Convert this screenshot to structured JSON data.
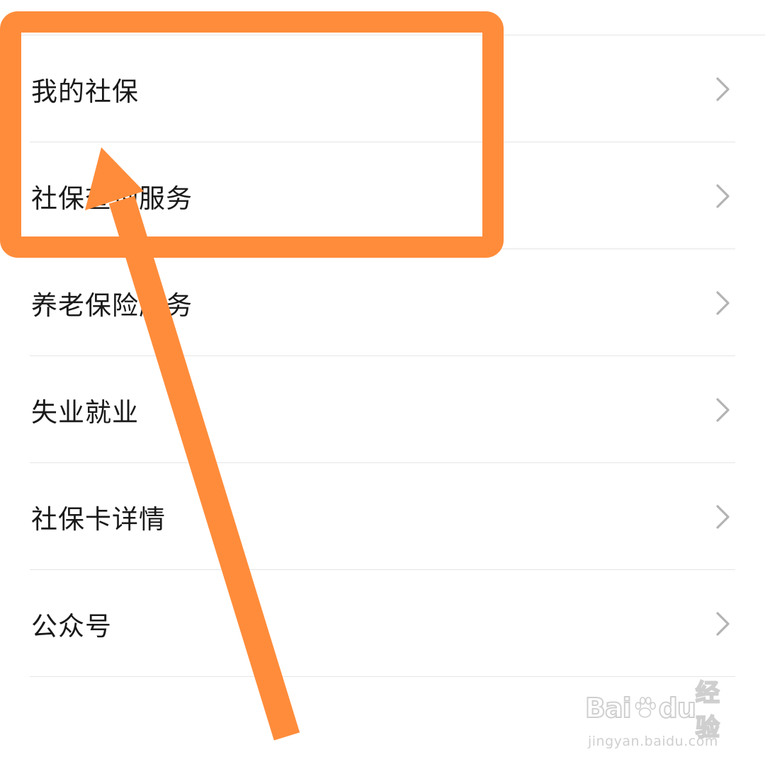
{
  "menu": {
    "items": [
      {
        "label": "我的社保"
      },
      {
        "label": "社保查询服务"
      },
      {
        "label": "养老保险服务"
      },
      {
        "label": "失业就业"
      },
      {
        "label": "社保卡详情"
      },
      {
        "label": "公众号"
      }
    ]
  },
  "watermark": {
    "brand": "Bai",
    "brand_suffix": "du",
    "product": "经验",
    "url": "jingyan.baidu.com"
  },
  "colors": {
    "annotation": "#FF8C3B",
    "text": "#1a1a1a",
    "chevron": "#b3b3b3",
    "divider": "#e5e5e5"
  },
  "icons": {
    "item_trailing": "chevron-right-icon",
    "watermark_logo": "baidu-paw-icon"
  }
}
